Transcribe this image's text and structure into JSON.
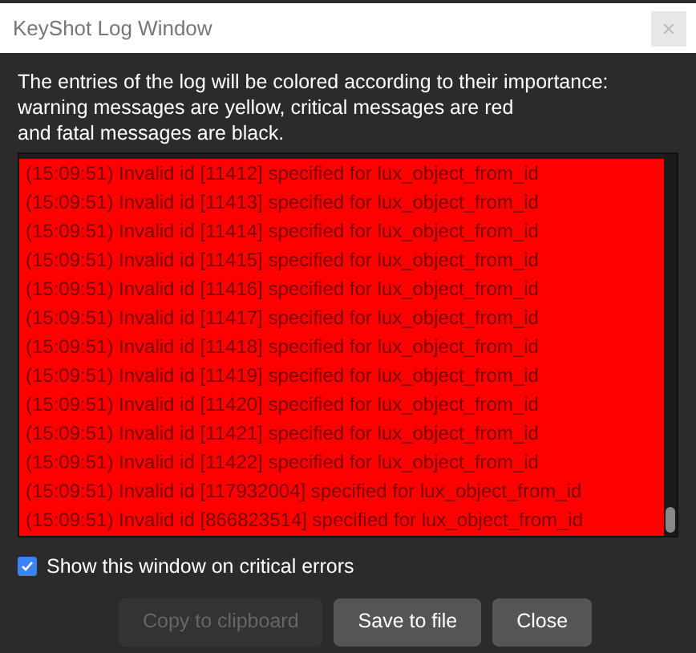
{
  "window": {
    "title": "KeyShot Log Window"
  },
  "intro": [
    "The entries of the log will be colored according to their importance:",
    "warning messages are yellow, critical messages are red",
    "and fatal messages are black."
  ],
  "log": [
    {
      "color": "#ff0000",
      "text": "(15:09:51) Invalid id [11412] specified for lux_object_from_id"
    },
    {
      "color": "#ff0000",
      "text": "(15:09:51) Invalid id [11413] specified for lux_object_from_id"
    },
    {
      "color": "#ff0000",
      "text": "(15:09:51) Invalid id [11414] specified for lux_object_from_id"
    },
    {
      "color": "#ff0000",
      "text": "(15:09:51) Invalid id [11415] specified for lux_object_from_id"
    },
    {
      "color": "#ff0000",
      "text": "(15:09:51) Invalid id [11416] specified for lux_object_from_id"
    },
    {
      "color": "#ff0000",
      "text": "(15:09:51) Invalid id [11417] specified for lux_object_from_id"
    },
    {
      "color": "#ff0000",
      "text": "(15:09:51) Invalid id [11418] specified for lux_object_from_id"
    },
    {
      "color": "#ff0000",
      "text": "(15:09:51) Invalid id [11419] specified for lux_object_from_id"
    },
    {
      "color": "#ff0000",
      "text": "(15:09:51) Invalid id [11420] specified for lux_object_from_id"
    },
    {
      "color": "#ff0000",
      "text": "(15:09:51) Invalid id [11421] specified for lux_object_from_id"
    },
    {
      "color": "#ff0000",
      "text": "(15:09:51) Invalid id [11422] specified for lux_object_from_id"
    },
    {
      "color": "#ff0000",
      "text": "(15:09:51) Invalid id [117932004] specified for lux_object_from_id"
    },
    {
      "color": "#ff0000",
      "text": "(15:09:51) Invalid id [866823514] specified for lux_object_from_id"
    }
  ],
  "show_on_errors": {
    "label": "Show this window on critical errors",
    "checked": true
  },
  "buttons": [
    {
      "label": "Copy to clipboard",
      "disabled": true
    },
    {
      "label": "Save to file",
      "disabled": false
    },
    {
      "label": "Close",
      "disabled": false
    }
  ]
}
